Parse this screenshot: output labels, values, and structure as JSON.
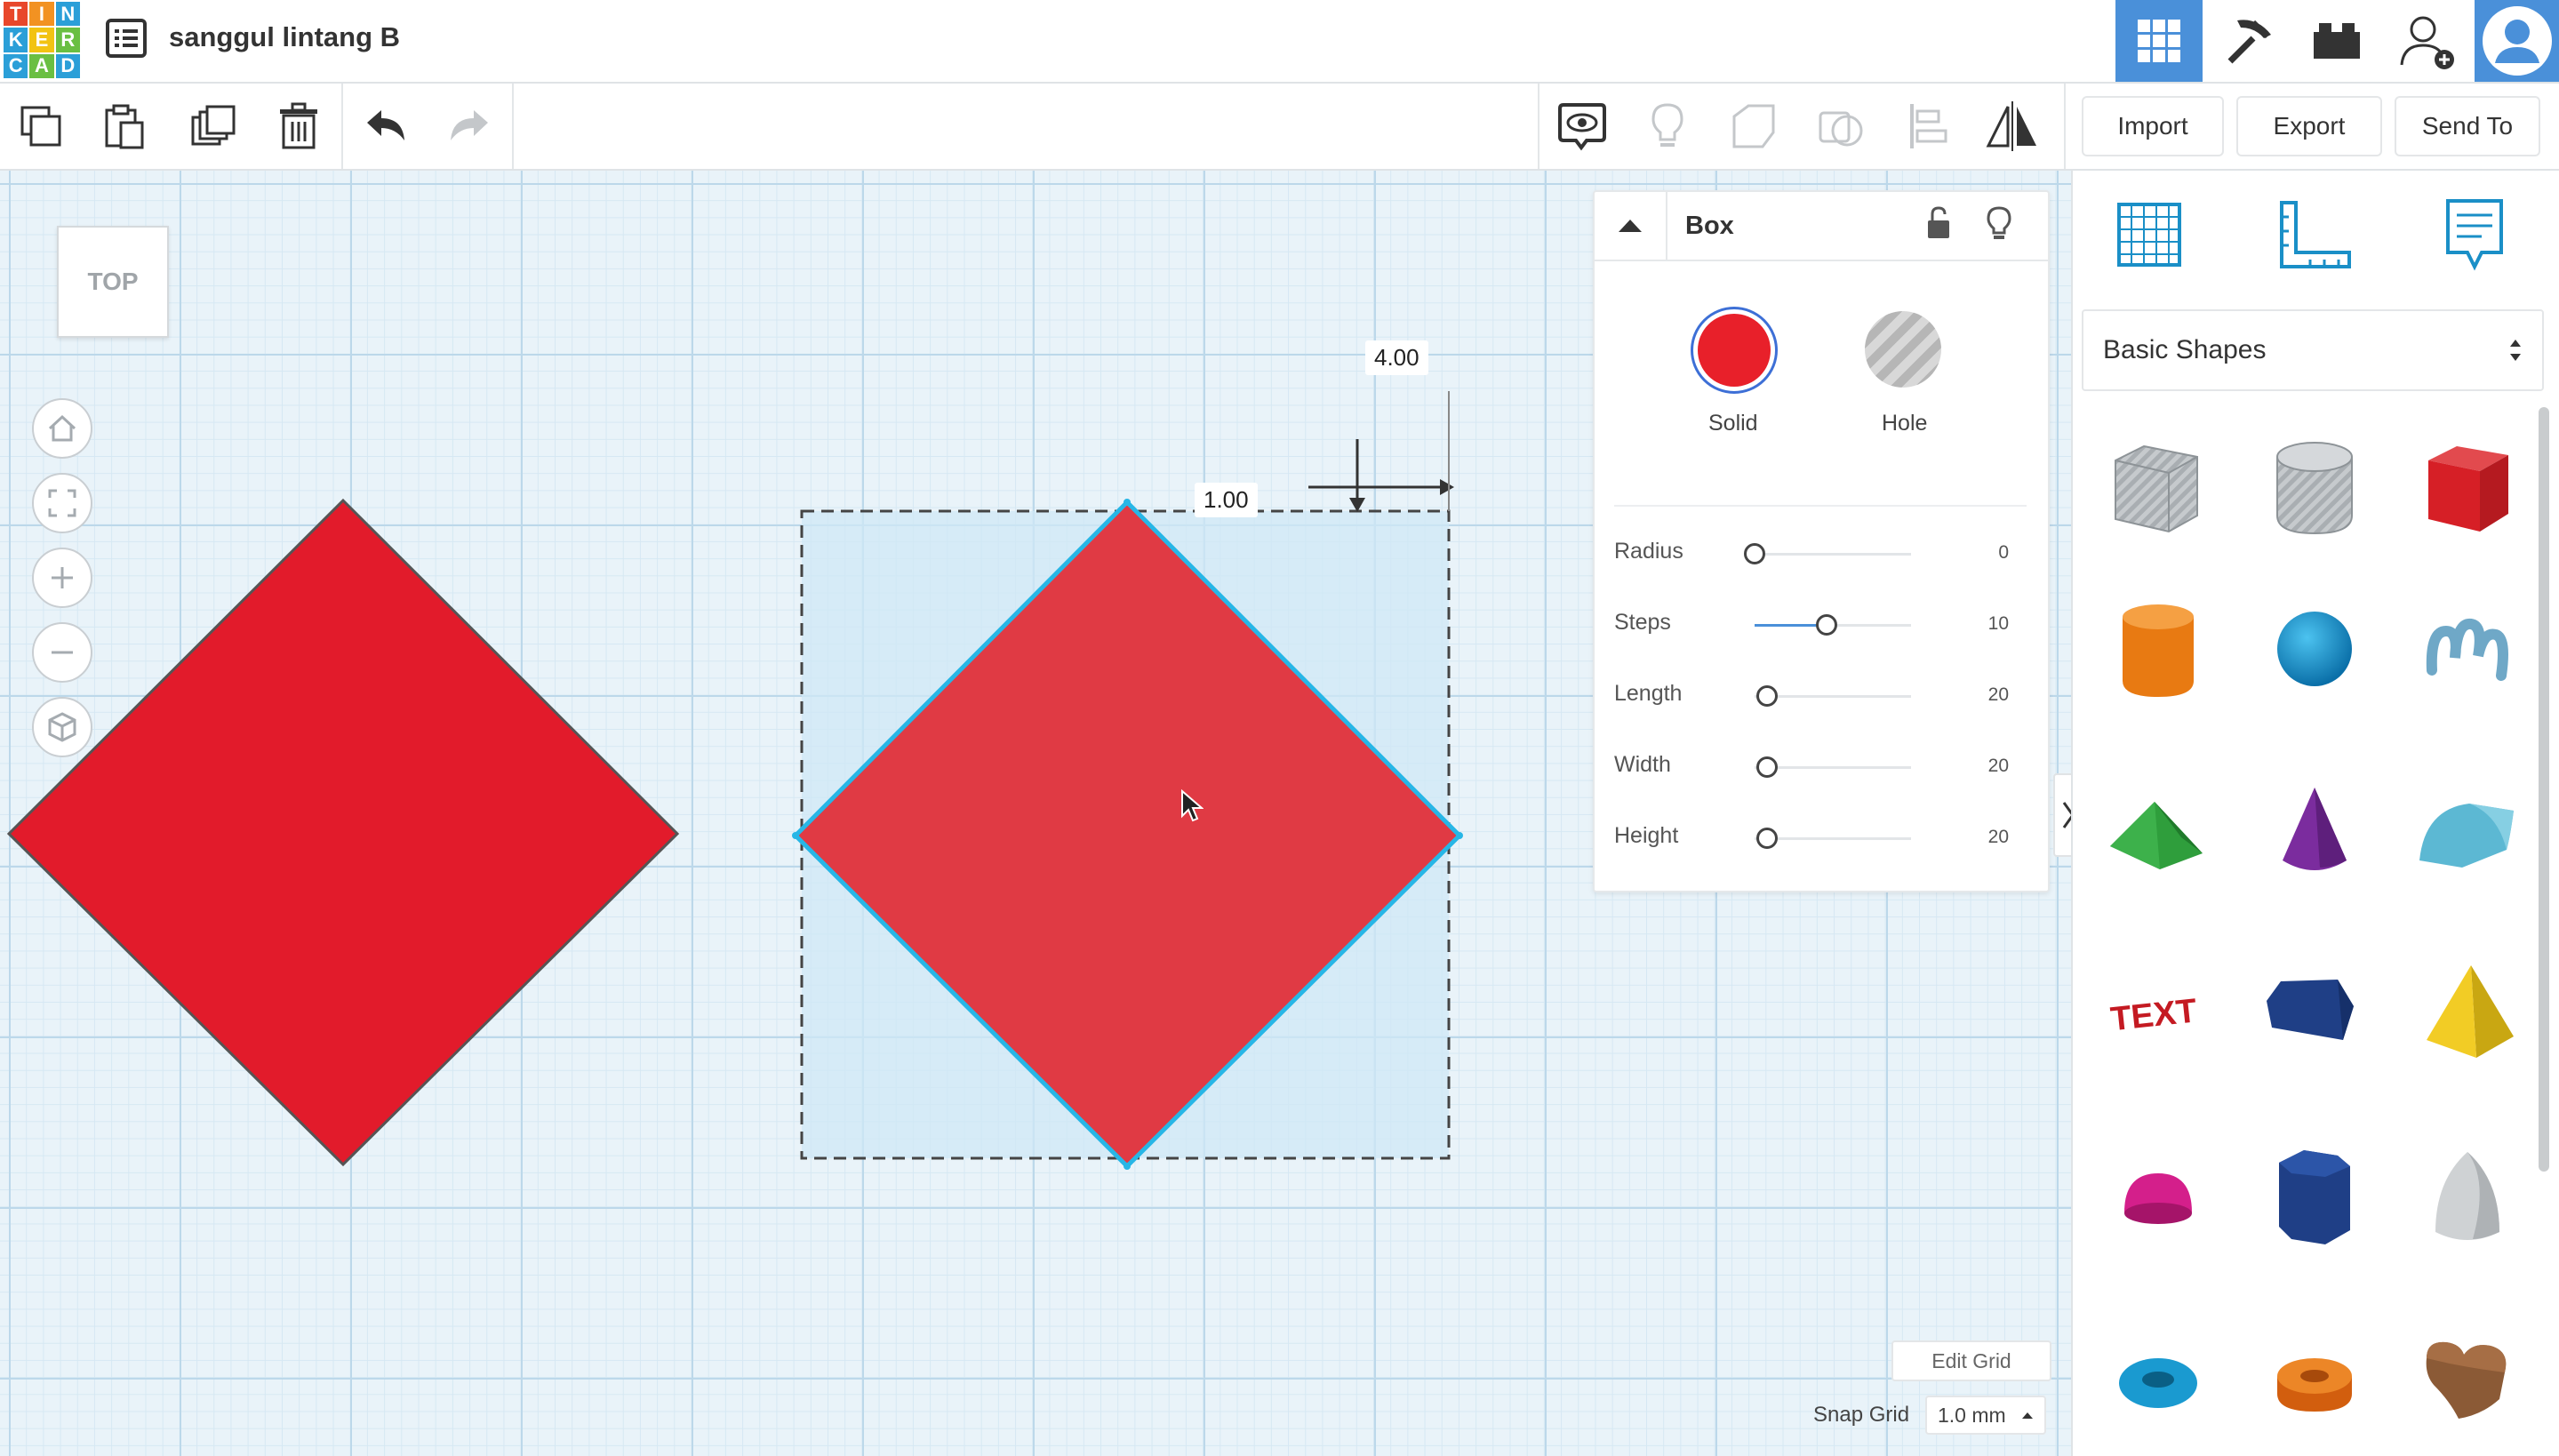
{
  "app": {
    "logo_letters": [
      "T",
      "I",
      "N",
      "K",
      "E",
      "R",
      "C",
      "A",
      "D"
    ],
    "logo_colors": [
      "#e8472b",
      "#f29222",
      "#2b9fd8",
      "#2b9fd8",
      "#f2c312",
      "#6abf42",
      "#2b9fd8",
      "#6abf42",
      "#2b9fd8"
    ],
    "design_title": "sanggul lintang B"
  },
  "topbar_icons": [
    "grid-view-icon",
    "pickaxe-icon",
    "brick-icon",
    "add-user-icon",
    "avatar"
  ],
  "toolbar": {
    "import_label": "Import",
    "export_label": "Export",
    "send_to_label": "Send To"
  },
  "viewcube": {
    "label": "TOP"
  },
  "dimensions": {
    "top_offset": "4.00",
    "width_dim": "1.00"
  },
  "inspector": {
    "title": "Box",
    "solid_label": "Solid",
    "hole_label": "Hole",
    "solid_color": "#e8202a",
    "params": [
      {
        "label": "Radius",
        "value": "0",
        "fraction": 0.0
      },
      {
        "label": "Steps",
        "value": "10",
        "fraction": 0.45
      },
      {
        "label": "Length",
        "value": "20",
        "fraction": 0.08
      },
      {
        "label": "Width",
        "value": "20",
        "fraction": 0.08
      },
      {
        "label": "Height",
        "value": "20",
        "fraction": 0.08
      }
    ]
  },
  "library": {
    "category": "Basic Shapes",
    "shapes": [
      "box-hole",
      "cylinder-hole",
      "box",
      "cylinder",
      "sphere",
      "scribble",
      "roof",
      "cone",
      "round-roof",
      "text",
      "polygon-prism",
      "pyramid",
      "half-sphere",
      "hexagonal-prism",
      "paraboloid",
      "torus",
      "tube",
      "heart"
    ]
  },
  "grid": {
    "edit_grid_label": "Edit Grid",
    "snap_grid_label": "Snap Grid",
    "snap_value": "1.0 mm"
  }
}
